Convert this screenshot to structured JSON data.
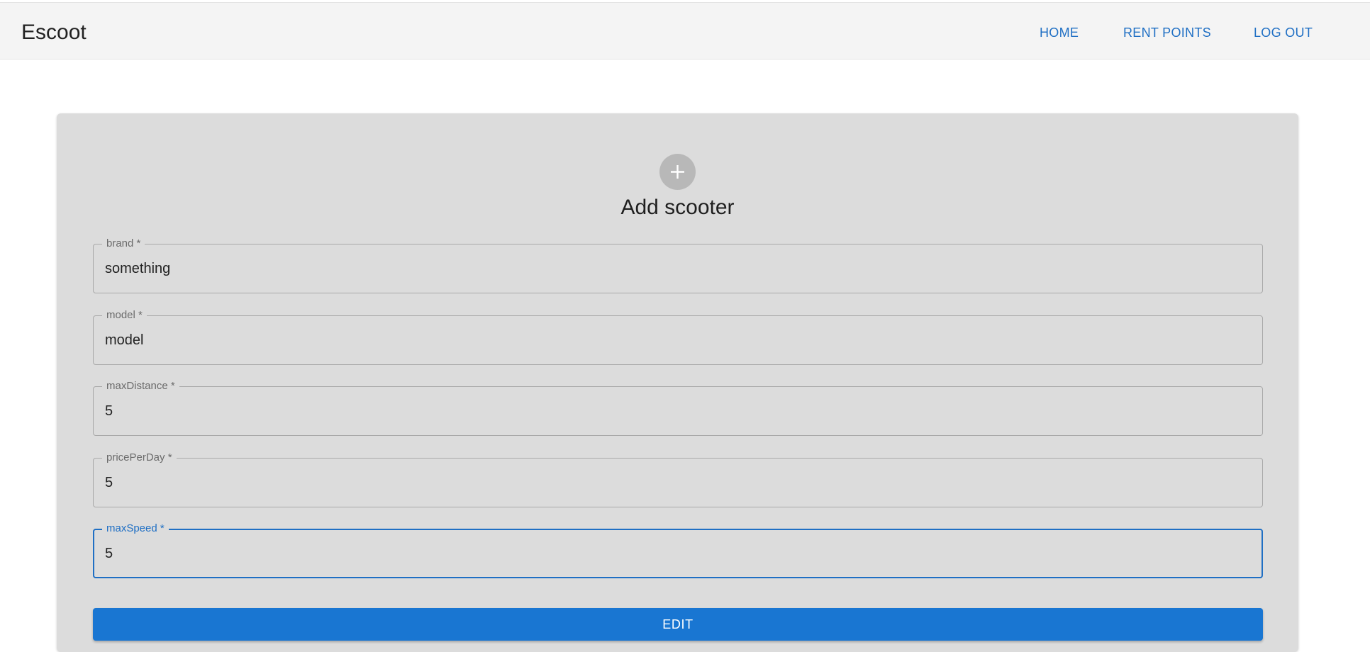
{
  "app": {
    "title": "Escoot"
  },
  "nav": {
    "home": "HOME",
    "rent_points": "RENT POINTS",
    "log_out": "LOG OUT"
  },
  "form": {
    "icon": "plus-icon",
    "title": "Add scooter",
    "fields": [
      {
        "name": "brand",
        "label": "brand *",
        "value": "something"
      },
      {
        "name": "model",
        "label": "model *",
        "value": "model"
      },
      {
        "name": "maxDistance",
        "label": "maxDistance *",
        "value": "5"
      },
      {
        "name": "pricePerDay",
        "label": "pricePerDay *",
        "value": "5"
      },
      {
        "name": "maxSpeed",
        "label": "maxSpeed *",
        "value": "5",
        "focused": true
      }
    ],
    "submit_label": "EDIT"
  },
  "colors": {
    "accent": "#1976d2",
    "link": "#1f6fc4",
    "card_bg": "#dcdcdc",
    "header_bg": "#f4f4f4"
  }
}
